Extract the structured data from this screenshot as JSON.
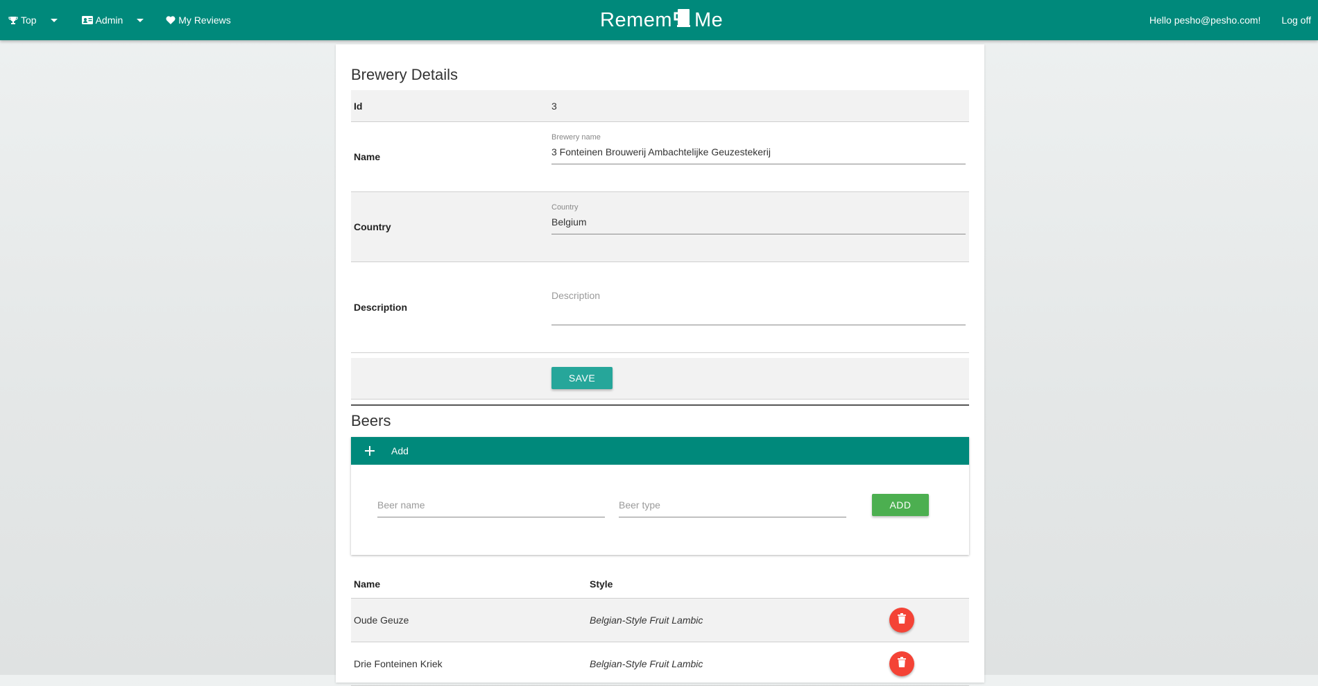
{
  "navbar": {
    "top_label": "Top",
    "admin_label": "Admin",
    "reviews_label": "My Reviews",
    "brand_left": "Remem",
    "brand_right": "Me",
    "greeting": "Hello pesho@pesho.com!",
    "logoff_label": "Log off",
    "color": "#00897b"
  },
  "details": {
    "title": "Brewery Details",
    "id_label": "Id",
    "id_value": "3",
    "name_label": "Name",
    "name_field_label": "Brewery name",
    "name_value": "3 Fonteinen Brouwerij Ambachtelijke Geuzestekerij",
    "country_label": "Country",
    "country_field_label": "Country",
    "country_value": "Belgium",
    "description_label": "Description",
    "description_placeholder": "Description",
    "save_label": "SAVE"
  },
  "beers": {
    "title": "Beers",
    "add_header_label": "Add",
    "beer_name_placeholder": "Beer name",
    "beer_type_placeholder": "Beer type",
    "add_button_label": "ADD",
    "columns": {
      "name": "Name",
      "style": "Style"
    },
    "rows": [
      {
        "name": "Oude Geuze",
        "style": "Belgian-Style Fruit Lambic"
      },
      {
        "name": "Drie Fonteinen Kriek",
        "style": "Belgian-Style Fruit Lambic"
      }
    ]
  },
  "icons": {
    "top": "trophy-icon",
    "admin": "id-card-icon",
    "reviews": "heart-icon",
    "brand": "beer-mug-icon",
    "delete": "trash-icon"
  },
  "colors": {
    "primary": "#00897b",
    "save": "#26a69a",
    "add": "#4caf50",
    "delete": "#f44336"
  }
}
